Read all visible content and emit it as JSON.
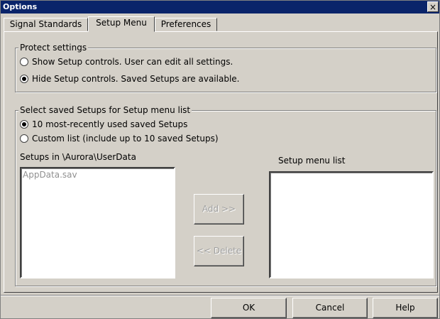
{
  "window": {
    "title": "Options",
    "close_label": "×"
  },
  "tabs": [
    {
      "label": "Signal Standards",
      "active": false
    },
    {
      "label": "Setup Menu",
      "active": true
    },
    {
      "label": "Preferences",
      "active": false
    }
  ],
  "protect": {
    "label": "Protect settings",
    "options": [
      {
        "label": "Show Setup controls.  User can edit all settings.",
        "checked": false
      },
      {
        "label": "Hide Setup controls.  Saved Setups are available.",
        "checked": true
      }
    ]
  },
  "saved": {
    "label": "Select saved Setups for Setup menu list",
    "options": [
      {
        "label": "10 most-recently used saved Setups",
        "checked": true
      },
      {
        "label": "Custom list (include up to 10 saved Setups)",
        "checked": false
      }
    ],
    "setups_label": "Setups in \\Aurora\\UserData",
    "setups_items": [
      "AppData.sav"
    ],
    "menu_label": "Setup menu list",
    "menu_items": [],
    "add_label": "Add >>",
    "delete_label": "<< Delete"
  },
  "footer": {
    "ok_label": "OK",
    "cancel_label": "Cancel",
    "help_label": "Help"
  }
}
